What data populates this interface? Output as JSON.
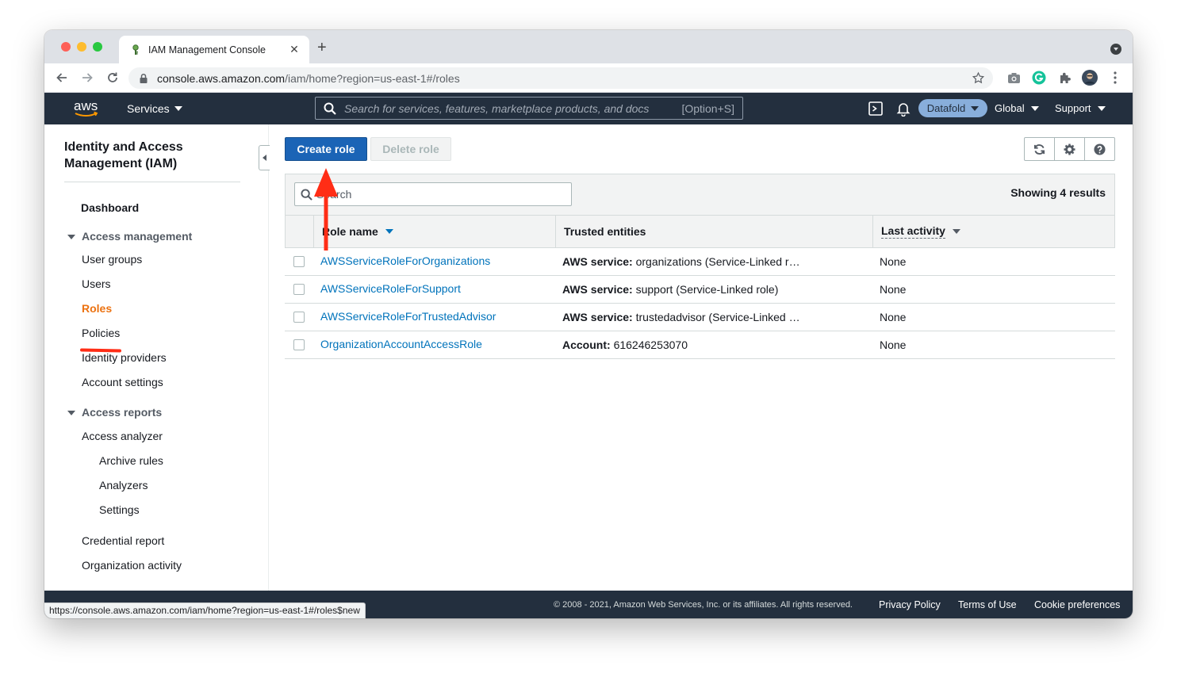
{
  "browser": {
    "tab_title": "IAM Management Console",
    "url_host": "console.aws.amazon.com",
    "url_path": "/iam/home?region=us-east-1#/roles",
    "status_url": "https://console.aws.amazon.com/iam/home?region=us-east-1#/roles$new"
  },
  "awsnav": {
    "logo_text": "aws",
    "services_label": "Services",
    "search_placeholder": "Search for services, features, marketplace products, and docs",
    "search_shortcut": "[Option+S]",
    "account_label": "Datafold",
    "region_label": "Global",
    "support_label": "Support"
  },
  "sidebar": {
    "title": "Identity and Access Management (IAM)",
    "dashboard": "Dashboard",
    "access_management": "Access management",
    "user_groups": "User groups",
    "users": "Users",
    "roles": "Roles",
    "policies": "Policies",
    "identity_providers": "Identity providers",
    "account_settings": "Account settings",
    "access_reports": "Access reports",
    "access_analyzer": "Access analyzer",
    "archive_rules": "Archive rules",
    "analyzers": "Analyzers",
    "settings": "Settings",
    "credential_report": "Credential report",
    "organization_activity": "Organization activity"
  },
  "toolbar": {
    "create_role": "Create role",
    "delete_role": "Delete role"
  },
  "table": {
    "search_placeholder": "Search",
    "showing": "Showing 4 results",
    "columns": {
      "role_name": "Role name",
      "trusted_entities": "Trusted entities",
      "last_activity": "Last activity"
    },
    "rows": [
      {
        "name": "AWSServiceRoleForOrganizations",
        "trusted_label": "AWS service:",
        "trusted_value": "organizations (Service-Linked r…",
        "activity": "None"
      },
      {
        "name": "AWSServiceRoleForSupport",
        "trusted_label": "AWS service:",
        "trusted_value": "support (Service-Linked role)",
        "activity": "None"
      },
      {
        "name": "AWSServiceRoleForTrustedAdvisor",
        "trusted_label": "AWS service:",
        "trusted_value": "trustedadvisor (Service-Linked …",
        "activity": "None"
      },
      {
        "name": "OrganizationAccountAccessRole",
        "trusted_label": "Account:",
        "trusted_value": "616246253070",
        "activity": "None"
      }
    ]
  },
  "footer": {
    "copyright": "© 2008 - 2021, Amazon Web Services, Inc. or its affiliates. All rights reserved.",
    "privacy": "Privacy Policy",
    "terms": "Terms of Use",
    "cookies": "Cookie preferences"
  },
  "colors": {
    "aws_nav": "#232f3e",
    "primary_button": "#1b64b6",
    "link": "#0073bb",
    "active_nav": "#ec7211",
    "annotation": "#ff2d16"
  }
}
